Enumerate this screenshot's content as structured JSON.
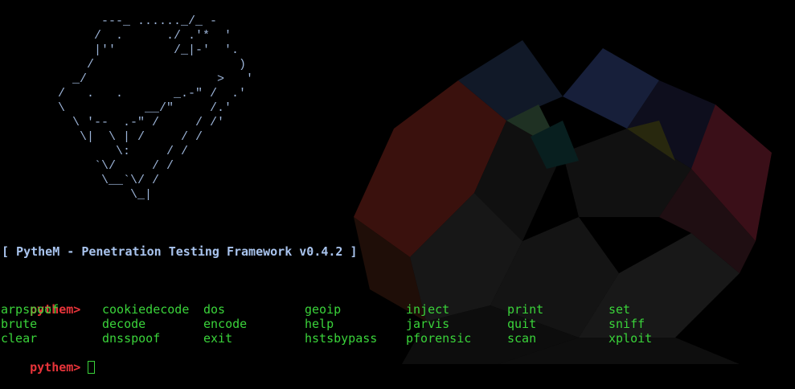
{
  "terminal": {
    "ascii_logo": [
      "              ---_ ......_/_ -",
      "             /  .      ./ .'*  '",
      "             |''        /_|-'  '.",
      "            /                    )",
      "          _/                  >   '",
      "        /   .   .       _.-\" /  .'",
      "        \\           __/\"     /.'",
      "          \\ '--  .-\" /     / /'",
      "           \\|  \\ | /     / /",
      "                \\:     / /",
      "             `\\/     / /",
      "              \\__`\\/ /",
      "                  \\_|"
    ],
    "banner": "[ PytheM - Penetration Testing Framework v0.4.2 ]",
    "prompt": "pythem>",
    "commands": [
      [
        "arpspoof",
        "cookiedecode",
        "dos",
        "geoip",
        "inject",
        "print",
        "set"
      ],
      [
        "brute",
        "decode",
        "encode",
        "help",
        "jarvis",
        "quit",
        "sniff"
      ],
      [
        "clear",
        "dnsspoof",
        "exit",
        "hstsbypass",
        "pforensic",
        "scan",
        "xploit"
      ]
    ]
  },
  "colors": {
    "ascii": "#9cb4d8",
    "banner": "#a9c4ee",
    "prompt": "#e8343a",
    "command": "#3ad33a",
    "background": "#000000"
  }
}
